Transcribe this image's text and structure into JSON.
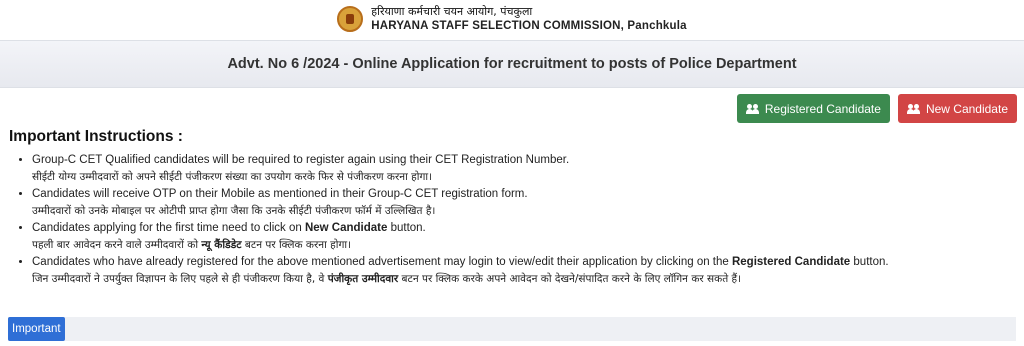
{
  "header": {
    "hindi_title": "हरियाणा कर्मचारी चयन आयोग, पंचकुला",
    "english_title": "HARYANA STAFF SELECTION COMMISSION, Panchkula"
  },
  "advt_title": "Advt. No 6 /2024 - Online Application for recruitment to posts of Police Department",
  "buttons": {
    "registered": "Registered Candidate",
    "new": "New Candidate"
  },
  "instructions": {
    "heading": "Important Instructions :",
    "items": [
      {
        "en": "Group-C CET Qualified candidates will be required to register again using their CET Registration Number.",
        "hi": "सीईटी योग्य उम्मीदवारों को अपने सीईटी पंजीकरण संख्या का उपयोग करके फिर से पंजीकरण करना होगा।"
      },
      {
        "en": "Candidates will receive OTP on their Mobile as mentioned in their Group-C CET registration form.",
        "hi": "उम्मीदवारों को उनके मोबाइल पर ओटीपी प्राप्त होगा जैसा कि उनके सीईटी पंजीकरण फॉर्म में उल्लिखित है।"
      },
      {
        "en_pre": "Candidates applying for the first time need to click on ",
        "en_bold": "New Candidate",
        "en_post": " button.",
        "hi_pre": "पहली बार आवेदन करने वाले उम्मीदवारों को ",
        "hi_bold": "न्यू कैंडिडेट",
        "hi_post": " बटन पर क्लिक करना होगा।"
      },
      {
        "en_pre": "Candidates who have already registered for the above mentioned advertisement may login to view/edit their application by clicking on the ",
        "en_bold": "Registered Candidate",
        "en_post": " button.",
        "hi_pre": "जिन उम्मीदवारों ने उपर्युक्त विज्ञापन के लिए पहले से ही पंजीकरण किया है, वे ",
        "hi_bold": "पंजीकृत उम्मीदवार",
        "hi_post": " बटन पर क्लिक करके अपने आवेदन को देखने/संपादित करने के लिए लॉगिन कर सकते हैं।"
      }
    ]
  },
  "important_badge": "Important",
  "icons": {
    "emblem": "haryana-emblem-icon",
    "users": "users-icon"
  },
  "colors": {
    "registered_button": "#3c8a4f",
    "new_button": "#d24545",
    "important_badge": "#2f6fd6"
  }
}
